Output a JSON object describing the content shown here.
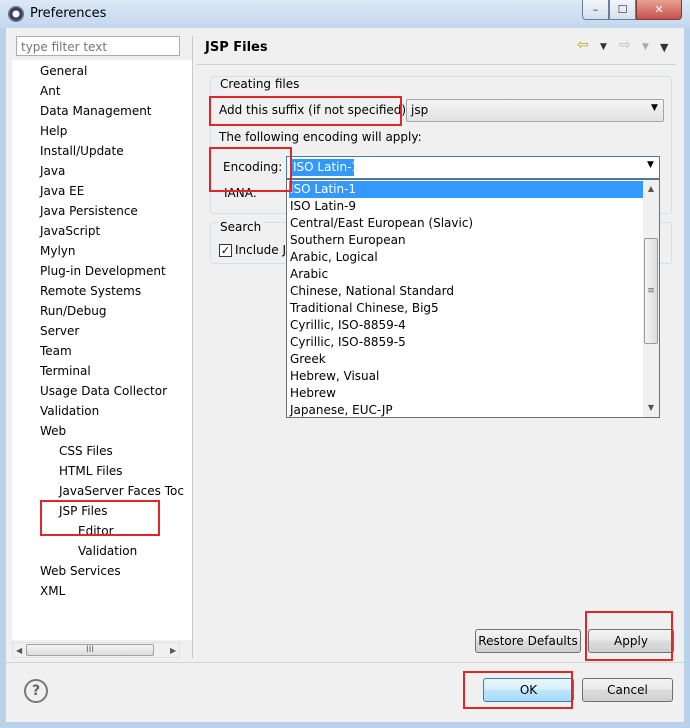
{
  "window": {
    "title": "Preferences",
    "controls": {
      "minimize": "–",
      "maximize": "☐",
      "close": "✕"
    }
  },
  "filter": {
    "placeholder": "type filter text"
  },
  "tree": {
    "items": [
      "General",
      "Ant",
      "Data Management",
      "Help",
      "Install/Update",
      "Java",
      "Java EE",
      "Java Persistence",
      "JavaScript",
      "Mylyn",
      "Plug-in Development",
      "Remote Systems",
      "Run/Debug",
      "Server",
      "Team",
      "Terminal",
      "Usage Data Collector",
      "Validation",
      "Web",
      "CSS Files",
      "HTML Files",
      "JavaServer Faces Toc",
      "JSP Files",
      "Editor",
      "Validation",
      "Web Services",
      "XML"
    ],
    "scroll_grip": "III",
    "scroll_left": "◀",
    "scroll_right": "▶"
  },
  "page": {
    "title": "JSP Files",
    "back_icon": "⇦",
    "forward_icon": "⇨",
    "menu_arrow": "▼"
  },
  "creating": {
    "group_label": "Creating files",
    "suffix_label": "Add this suffix (if not specified)",
    "suffix_value": "jsp",
    "encoding_info": "The following encoding will apply:",
    "encoding_label": "Encoding:",
    "encoding_value": "ISO Latin-1",
    "iana_label": "IANA:",
    "combo_arrow": "▼"
  },
  "search": {
    "group_label": "Search",
    "include_label": "Include J",
    "checkmark": "✓"
  },
  "dropdown": {
    "items": [
      "ISO Latin-1",
      "ISO Latin-9",
      "Central/East European (Slavic)",
      "Southern European",
      "Arabic, Logical",
      "Arabic",
      "Chinese, National Standard",
      "Traditional Chinese, Big5",
      "Cyrillic, ISO-8859-4",
      "Cyrillic, ISO-8859-5",
      "Greek",
      "Hebrew, Visual",
      "Hebrew",
      "Japanese, EUC-JP"
    ],
    "selected_index": 0,
    "scroll_up": "▲",
    "scroll_down": "▼",
    "scroll_grip": "≡"
  },
  "buttons": {
    "restore": "Restore Defaults",
    "apply": "Apply",
    "ok": "OK",
    "cancel": "Cancel",
    "help": "?"
  },
  "colors": {
    "highlight_box": "#e0262b",
    "selection": "#3399ff"
  }
}
